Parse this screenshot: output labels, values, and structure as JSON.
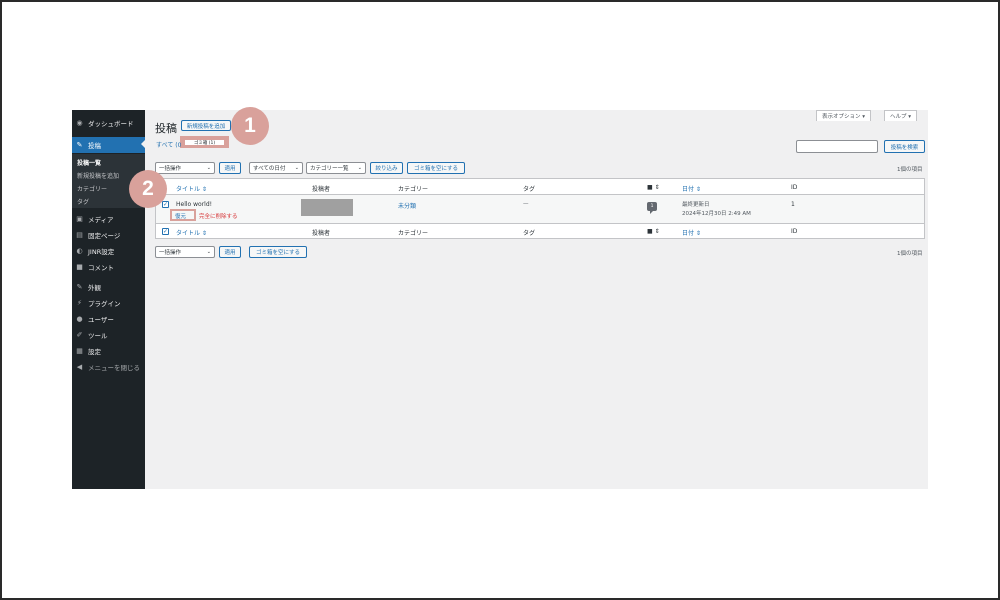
{
  "sidebar": {
    "items": [
      {
        "label": "ダッシュボード",
        "icon": "dashboard-icon",
        "glyph": "◉"
      },
      {
        "label": "投稿",
        "icon": "pin-icon",
        "glyph": "📌"
      },
      {
        "label": "メディア",
        "icon": "media-icon",
        "glyph": "▣"
      },
      {
        "label": "固定ページ",
        "icon": "page-icon",
        "glyph": "▤"
      },
      {
        "label": "JINR設定",
        "icon": "jinr-icon",
        "glyph": "◐"
      },
      {
        "label": "コメント",
        "icon": "comment-icon",
        "glyph": "■"
      },
      {
        "label": "外観",
        "icon": "brush-icon",
        "glyph": "✎"
      },
      {
        "label": "プラグイン",
        "icon": "plugin-icon",
        "glyph": "⚡"
      },
      {
        "label": "ユーザー",
        "icon": "user-icon",
        "glyph": "●"
      },
      {
        "label": "ツール",
        "icon": "wrench-icon",
        "glyph": "✐"
      },
      {
        "label": "設定",
        "icon": "settings-icon",
        "glyph": "▦"
      },
      {
        "label": "メニューを閉じる",
        "icon": "collapse-icon",
        "glyph": "◀"
      }
    ],
    "submenu": [
      "投稿一覧",
      "新規投稿を追加",
      "カテゴリー",
      "タグ"
    ]
  },
  "header": {
    "title": "投稿",
    "add_new": "新規投稿を追加",
    "screen_options": "表示オプション ▾",
    "help": "ヘルプ ▾"
  },
  "filters": {
    "all_prefix": "すべて (0",
    "trash_label": "ゴミ箱 (1)",
    "search_button": "投稿を検索",
    "bulk_action": "一括操作",
    "apply": "適用",
    "all_dates": "すべての日付",
    "all_categories": "カテゴリー一覧",
    "filter": "絞り込み",
    "empty_trash": "ゴミ箱を空にする",
    "item_count": "1個の項目"
  },
  "table": {
    "columns": {
      "title": "タイトル ⇕",
      "author": "投稿者",
      "categories": "カテゴリー",
      "tags": "タグ",
      "comments": "■ ⇕",
      "date": "日付 ⇕",
      "id": "ID"
    },
    "row": {
      "checked": "✓",
      "title": "Hello world!",
      "action_restore": "復元",
      "action_delete": "完全に削除する",
      "category": "未分類",
      "tags": "—",
      "comments": "1",
      "date_status": "最終更新日",
      "date": "2024年12月30日 2:49 AM",
      "id": "1"
    }
  },
  "markers": {
    "one": "1",
    "two": "2"
  },
  "colors": {
    "accent": "#2271b1",
    "sidebar": "#1d2327",
    "highlight": "#d9a19b",
    "delete": "#d63638"
  }
}
